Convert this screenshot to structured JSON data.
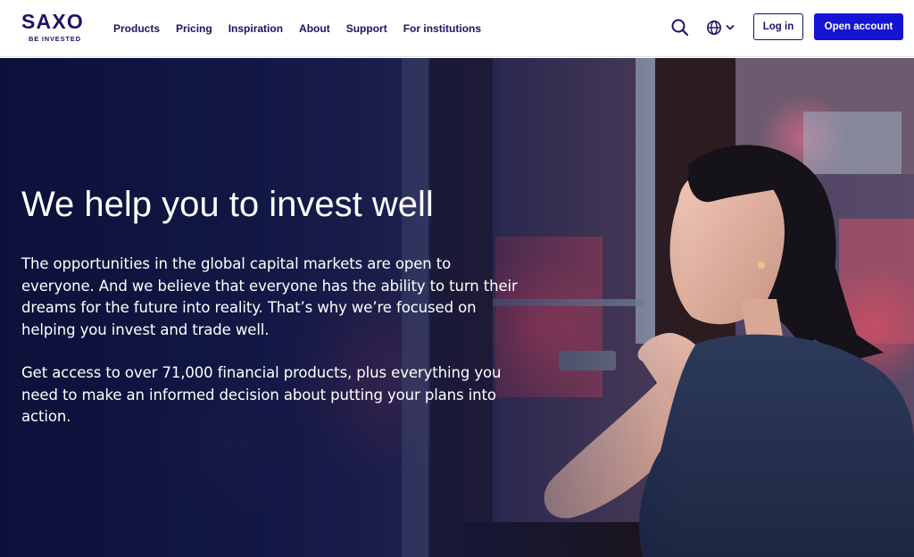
{
  "brand": {
    "name": "SAXO",
    "tagline": "BE INVESTED"
  },
  "nav": {
    "items": [
      {
        "label": "Products"
      },
      {
        "label": "Pricing"
      },
      {
        "label": "Inspiration"
      },
      {
        "label": "About"
      },
      {
        "label": "Support"
      },
      {
        "label": "For institutions"
      }
    ]
  },
  "header_actions": {
    "search_icon": "search-icon",
    "language_icon": "globe-icon",
    "login_label": "Log in",
    "open_account_label": "Open account"
  },
  "hero": {
    "title": "We help you to invest well",
    "paragraph_1": "The opportunities in the global capital markets are open to everyone. And we believe that everyone has the ability to turn their dreams for the future into reality. That’s why we’re focused on helping you invest and trade well.",
    "paragraph_2": "Get access to over 71,000 financial products, plus everything you need to make an informed decision about putting your plans into action."
  },
  "colors": {
    "brand_navy": "#1b1464",
    "primary_blue": "#1414d2",
    "hero_overlay": "#0a1038"
  }
}
